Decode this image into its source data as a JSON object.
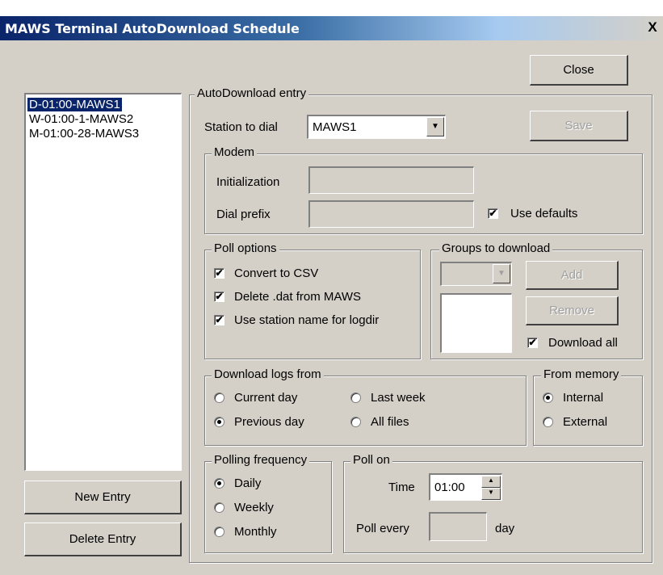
{
  "window": {
    "title": "MAWS Terminal AutoDownload Schedule",
    "close_glyph": "X"
  },
  "entries": [
    "D-01:00-MAWS1",
    "W-01:00-1-MAWS2",
    "M-01:00-28-MAWS3"
  ],
  "buttons": {
    "close": "Close",
    "save": "Save",
    "new_entry": "New Entry",
    "delete_entry": "Delete Entry",
    "add": "Add",
    "remove": "Remove"
  },
  "autodownload": {
    "group_label": "AutoDownload entry",
    "station_label": "Station to dial",
    "station_value": "MAWS1"
  },
  "modem": {
    "group_label": "Modem",
    "init_label": "Initialization",
    "init_value": "",
    "prefix_label": "Dial prefix",
    "prefix_value": "",
    "use_defaults_label": "Use defaults",
    "use_defaults_checked": true
  },
  "poll_options": {
    "group_label": "Poll options",
    "items": [
      {
        "label": "Convert to CSV",
        "checked": true
      },
      {
        "label": "Delete .dat from MAWS",
        "checked": true
      },
      {
        "label": "Use station name for logdir",
        "checked": true
      }
    ]
  },
  "groups": {
    "group_label": "Groups to download",
    "download_all_label": "Download all",
    "download_all_checked": true
  },
  "download_logs": {
    "group_label": "Download logs from",
    "options": [
      {
        "label": "Current day",
        "selected": false
      },
      {
        "label": "Last week",
        "selected": false
      },
      {
        "label": "Previous day",
        "selected": true
      },
      {
        "label": "All files",
        "selected": false
      }
    ]
  },
  "memory": {
    "group_label": "From memory",
    "options": [
      {
        "label": "Internal",
        "selected": true
      },
      {
        "label": "External",
        "selected": false
      }
    ]
  },
  "polling_frequency": {
    "group_label": "Polling frequency",
    "options": [
      {
        "label": "Daily",
        "selected": true
      },
      {
        "label": "Weekly",
        "selected": false
      },
      {
        "label": "Monthly",
        "selected": false
      }
    ]
  },
  "poll_on": {
    "group_label": "Poll on",
    "time_label": "Time",
    "time_value": "01:00",
    "every_label": "Poll every",
    "every_value": "",
    "unit_label": "day"
  },
  "icons": {
    "check": "check-icon",
    "dropdown": "chevron-down-icon",
    "spin_up": "spin-up-icon",
    "spin_down": "spin-down-icon"
  }
}
